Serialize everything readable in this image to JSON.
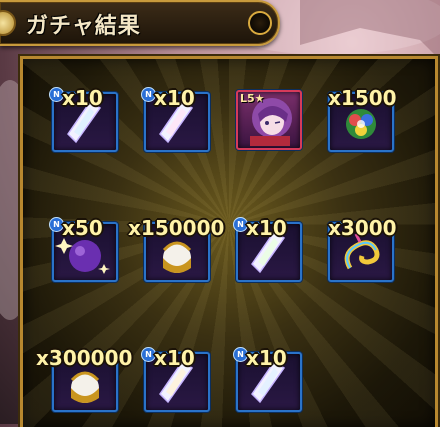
{
  "header": {
    "title": "ガチャ結果"
  },
  "items": [
    {
      "id": "crystal-1",
      "kind": "crystal",
      "quantity": "x10",
      "badge": true
    },
    {
      "id": "crystal-2",
      "kind": "crystal",
      "quantity": "x10",
      "badge": true
    },
    {
      "id": "character",
      "kind": "character",
      "quantity": "",
      "badge": false,
      "rank": "L5★"
    },
    {
      "id": "rainbow-orb",
      "kind": "orb",
      "quantity": "x1500",
      "badge": false
    },
    {
      "id": "purple-sphere",
      "kind": "sphere",
      "quantity": "x50",
      "badge": true
    },
    {
      "id": "golden-egg-1",
      "kind": "egg",
      "quantity": "x150000",
      "badge": false
    },
    {
      "id": "crystal-3",
      "kind": "crystal",
      "quantity": "x10",
      "badge": true
    },
    {
      "id": "rainbow-swirl",
      "kind": "swirl",
      "quantity": "x3000",
      "badge": false
    },
    {
      "id": "golden-egg-2",
      "kind": "egg",
      "quantity": "x300000",
      "badge": false
    },
    {
      "id": "crystal-4",
      "kind": "crystal",
      "quantity": "x10",
      "badge": true
    },
    {
      "id": "crystal-5",
      "kind": "crystal",
      "quantity": "x10",
      "badge": true
    }
  ]
}
